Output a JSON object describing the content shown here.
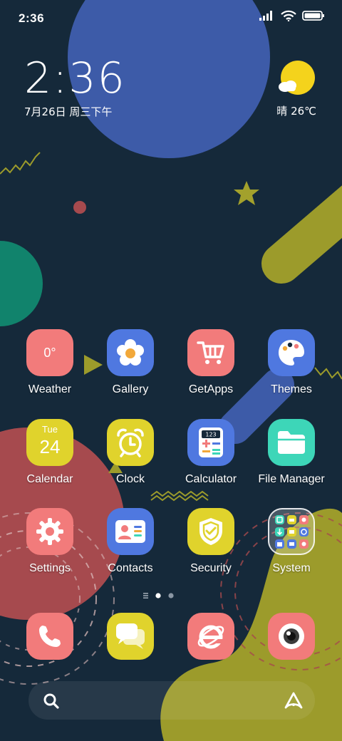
{
  "status_bar": {
    "time": "2:36",
    "icons": [
      "signal-icon",
      "wifi-icon",
      "battery-icon"
    ]
  },
  "clock_widget": {
    "time": "2:36",
    "date": "7月26日 周三下午"
  },
  "weather_widget": {
    "condition": "晴",
    "temperature": "26℃",
    "text": "晴 26℃",
    "icon": "sun-cloud-icon"
  },
  "apps": [
    {
      "label": "Weather",
      "icon": "weather-icon",
      "color": "#f27b7b",
      "glyph": "0°"
    },
    {
      "label": "Gallery",
      "icon": "flower-icon",
      "color": "#4f78e0"
    },
    {
      "label": "GetApps",
      "icon": "shopping-cart-icon",
      "color": "#f27b7b"
    },
    {
      "label": "Themes",
      "icon": "palette-icon",
      "color": "#4f78e0"
    },
    {
      "label": "Calendar",
      "icon": "calendar-icon",
      "color": "#e0d32c",
      "day": "Tue",
      "date": "24"
    },
    {
      "label": "Clock",
      "icon": "alarm-clock-icon",
      "color": "#e0d32c"
    },
    {
      "label": "Calculator",
      "icon": "calculator-icon",
      "color": "#4f78e0",
      "display": "123"
    },
    {
      "label": "File Manager",
      "icon": "folder-icon",
      "color": "#3dd6b8"
    },
    {
      "label": "Settings",
      "icon": "gear-icon",
      "color": "#f27b7b"
    },
    {
      "label": "Contacts",
      "icon": "contact-card-icon",
      "color": "#4f78e0"
    },
    {
      "label": "Security",
      "icon": "shield-icon",
      "color": "#e0d32c"
    },
    {
      "label": "System",
      "icon": "folder-grid-icon",
      "color": "rgba(255,255,255,0.25)"
    }
  ],
  "page_indicator": {
    "pages": 2,
    "current": 1,
    "has_feed": true
  },
  "dock": [
    {
      "name": "phone",
      "icon": "phone-icon",
      "color": "#f27b7b"
    },
    {
      "name": "messages",
      "icon": "chat-bubble-icon",
      "color": "#e0d32c"
    },
    {
      "name": "browser",
      "icon": "browser-e-icon",
      "color": "#f27b7b"
    },
    {
      "name": "camera",
      "icon": "camera-lens-icon",
      "color": "#f27b7b"
    }
  ],
  "search_bar": {
    "left_icon": "search-icon",
    "right_icon": "assistant-a-icon"
  },
  "wallpaper_colors": {
    "background": "#15293a",
    "blue": "#3d5ba8",
    "green": "#11836c",
    "olive": "#9c9b2b",
    "red": "#a64a4e",
    "star": "#a3a12c"
  }
}
